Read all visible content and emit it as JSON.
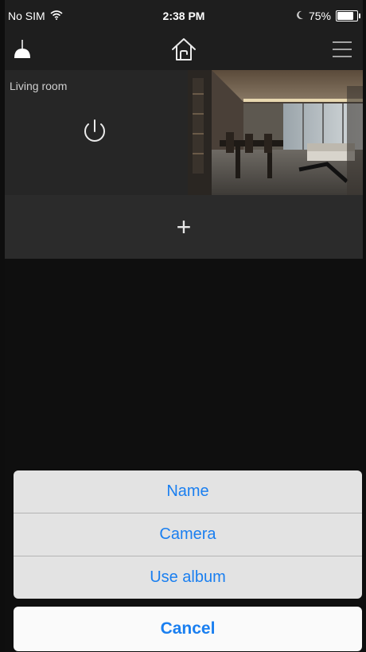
{
  "status_bar": {
    "carrier": "No SIM",
    "time": "2:38 PM",
    "battery_percent": "75%",
    "battery_level": 0.75,
    "icons": [
      "wifi-icon",
      "moon-icon",
      "battery-icon"
    ]
  },
  "nav_bar": {
    "left_icon": "ceiling-lamp-icon",
    "center_icon": "home-icon",
    "right_icon": "hamburger-menu-icon"
  },
  "room": {
    "name": "Living room",
    "power_icon": "power-icon",
    "photo": "living-room-photo"
  },
  "add_tile": {
    "label": "+"
  },
  "action_sheet": {
    "items": [
      {
        "label": "Name"
      },
      {
        "label": "Camera"
      },
      {
        "label": "Use album"
      }
    ],
    "cancel_label": "Cancel"
  },
  "colors": {
    "background": "#0f0f0f",
    "bars": "#1e1e1e",
    "tile": "#262626",
    "accent": "#1a7ff0"
  }
}
